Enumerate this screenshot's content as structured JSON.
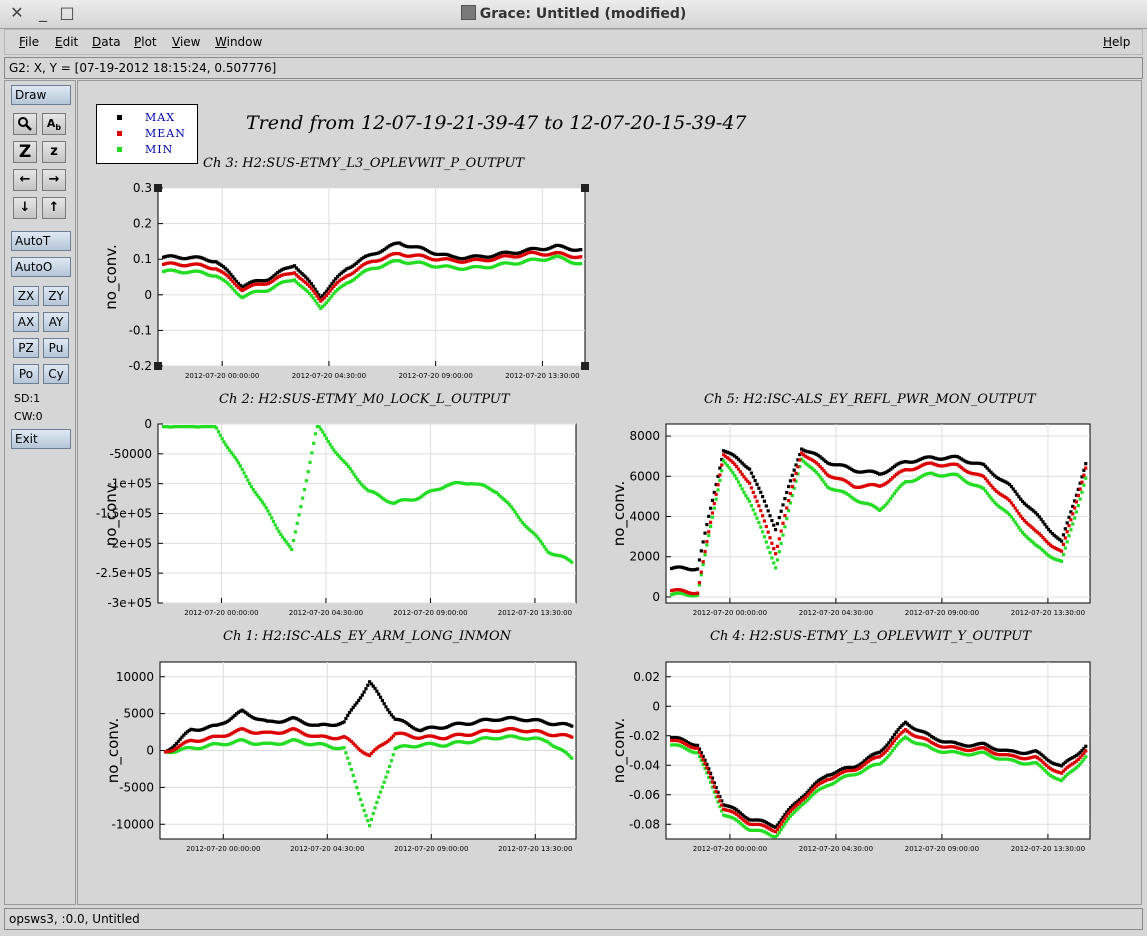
{
  "window": {
    "title": "Grace: Untitled (modified)"
  },
  "menu": {
    "items": [
      "File",
      "Edit",
      "Data",
      "Plot",
      "View",
      "Window"
    ],
    "help": "Help"
  },
  "locator": {
    "text": "G2: X, Y = [07-19-2012 18:15:24, 0.507776]"
  },
  "toolbar": {
    "draw": "Draw",
    "autot": "AutoT",
    "autoo": "AutoO",
    "exit": "Exit",
    "zx": "ZX",
    "zy": "ZY",
    "ax": "AX",
    "ay": "AY",
    "pz": "PZ",
    "pu": "Pu",
    "po": "Po",
    "cy": "Cy",
    "sd": "SD:1",
    "cw": "CW:0",
    "icons": {
      "zoom": "Z",
      "z_small": "z"
    }
  },
  "status": {
    "text": "opsws3, :0.0, Untitled"
  },
  "plot": {
    "main_title": "Trend from 12-07-19-21-39-47 to 12-07-20-15-39-47",
    "legend": [
      "MAX",
      "MEAN",
      "MIN"
    ],
    "colors": {
      "max": "#000000",
      "mean": "#dd0000",
      "min": "#22dd22"
    }
  },
  "chart_data": [
    {
      "type": "scatter",
      "title": "Ch 3: H2:SUS-ETMY_L3_OPLEVWIT_P_OUTPUT",
      "ylabel": "no_conv.",
      "x_ticks": [
        "2012-07-20 00:00:00",
        "2012-07-20 04:30:00",
        "2012-07-20 09:00:00",
        "2012-07-20 13:30:00"
      ],
      "y_ticks": [
        "0.3",
        "0.2",
        "0.1",
        "0",
        "-0.1",
        "-0.2"
      ],
      "ylim": [
        -0.2,
        0.3
      ],
      "series": [
        {
          "name": "MAX",
          "values": [
            0.11,
            0.11,
            0.1,
            0.03,
            0.05,
            0.09,
            0.0,
            0.08,
            0.12,
            0.15,
            0.13,
            0.11,
            0.11,
            0.12,
            0.13,
            0.14,
            0.13
          ]
        },
        {
          "name": "MEAN",
          "values": [
            0.09,
            0.09,
            0.08,
            0.02,
            0.04,
            0.07,
            -0.01,
            0.06,
            0.1,
            0.12,
            0.11,
            0.1,
            0.1,
            0.11,
            0.12,
            0.12,
            0.11
          ]
        },
        {
          "name": "MIN",
          "values": [
            0.07,
            0.07,
            0.06,
            0.0,
            0.02,
            0.05,
            -0.03,
            0.04,
            0.08,
            0.1,
            0.09,
            0.08,
            0.08,
            0.09,
            0.1,
            0.11,
            0.09
          ]
        }
      ]
    },
    {
      "type": "scatter",
      "title": "Ch 2: H2:SUS-ETMY_M0_LOCK_L_OUTPUT",
      "ylabel": "no_conv.",
      "x_ticks": [
        "2012-07-20 00:00:00",
        "2012-07-20 04:30:00",
        "2012-07-20 09:00:00",
        "2012-07-20 13:30:00"
      ],
      "y_ticks": [
        "0",
        "-50000",
        "-1e+05",
        "-1.5e+05",
        "-2e+05",
        "-2.5e+05",
        "-3e+05"
      ],
      "ylim": [
        -300000,
        0
      ],
      "series": [
        {
          "name": "MEAN",
          "values": [
            0,
            0,
            0,
            -70000,
            -140000,
            -210000,
            0,
            -60000,
            -110000,
            -130000,
            -120000,
            -100000,
            -95000,
            -110000,
            -160000,
            -210000,
            -230000
          ]
        }
      ]
    },
    {
      "type": "scatter",
      "title": "Ch 5: H2:ISC-ALS_EY_REFL_PWR_MON_OUTPUT",
      "ylabel": "no_conv.",
      "x_ticks": [
        "2012-07-20 00:00:00",
        "2012-07-20 04:30:00",
        "2012-07-20 09:00:00",
        "2012-07-20 13:30:00"
      ],
      "y_ticks": [
        "8000",
        "6000",
        "4000",
        "2000",
        "0"
      ],
      "ylim": [
        -300,
        8600
      ],
      "series": [
        {
          "name": "MAX",
          "values": [
            1500,
            1500,
            7400,
            6500,
            3500,
            7500,
            6800,
            6400,
            6200,
            6800,
            7000,
            7000,
            6600,
            5600,
            4200,
            2800,
            7000
          ]
        },
        {
          "name": "MEAN",
          "values": [
            400,
            300,
            7200,
            5800,
            2300,
            7300,
            6200,
            5600,
            5600,
            6400,
            6700,
            6600,
            6000,
            4800,
            3300,
            2300,
            6800
          ]
        },
        {
          "name": "MIN",
          "values": [
            200,
            200,
            6900,
            4900,
            1600,
            7000,
            5600,
            5000,
            4400,
            5800,
            6200,
            6100,
            5400,
            4100,
            2600,
            1800,
            6300
          ]
        }
      ]
    },
    {
      "type": "scatter",
      "title": "Ch 1: H2:ISC-ALS_EY_ARM_LONG_INMON",
      "ylabel": "no_conv.",
      "x_ticks": [
        "2012-07-20 00:00:00",
        "2012-07-20 04:30:00",
        "2012-07-20 09:00:00",
        "2012-07-20 13:30:00"
      ],
      "y_ticks": [
        "10000",
        "5000",
        "0",
        "-5000",
        "-10000"
      ],
      "ylim": [
        -12000,
        12000
      ],
      "series": [
        {
          "name": "MAX",
          "values": [
            0,
            3000,
            3500,
            5500,
            4000,
            4500,
            3500,
            4000,
            9500,
            4500,
            3000,
            3500,
            4000,
            4500,
            4500,
            4000,
            3500
          ]
        },
        {
          "name": "MEAN",
          "values": [
            0,
            1500,
            2000,
            3000,
            2500,
            3000,
            2000,
            2000,
            -500,
            2500,
            2000,
            2000,
            2500,
            3000,
            3000,
            2500,
            2000
          ]
        },
        {
          "name": "MIN",
          "values": [
            0,
            500,
            1000,
            1500,
            1000,
            1500,
            1000,
            500,
            -10000,
            500,
            1000,
            1000,
            1500,
            2000,
            2000,
            1500,
            -1000
          ]
        }
      ]
    },
    {
      "type": "scatter",
      "title": "Ch 4: H2:SUS-ETMY_L3_OPLEVWIT_Y_OUTPUT",
      "ylabel": "no_conv.",
      "x_ticks": [
        "2012-07-20 00:00:00",
        "2012-07-20 04:30:00",
        "2012-07-20 09:00:00",
        "2012-07-20 13:30:00"
      ],
      "y_ticks": [
        "0.02",
        "0",
        "-0.02",
        "-0.04",
        "-0.06",
        "-0.08"
      ],
      "ylim": [
        -0.09,
        0.03
      ],
      "series": [
        {
          "name": "MAX",
          "values": [
            -0.02,
            -0.025,
            -0.065,
            -0.075,
            -0.08,
            -0.06,
            -0.045,
            -0.04,
            -0.03,
            -0.01,
            -0.02,
            -0.025,
            -0.025,
            -0.03,
            -0.03,
            -0.04,
            -0.025
          ]
        },
        {
          "name": "MEAN",
          "values": [
            -0.022,
            -0.027,
            -0.068,
            -0.078,
            -0.083,
            -0.062,
            -0.048,
            -0.042,
            -0.033,
            -0.015,
            -0.024,
            -0.028,
            -0.028,
            -0.033,
            -0.034,
            -0.045,
            -0.028
          ]
        },
        {
          "name": "MIN",
          "values": [
            -0.025,
            -0.03,
            -0.072,
            -0.082,
            -0.087,
            -0.065,
            -0.052,
            -0.045,
            -0.038,
            -0.02,
            -0.028,
            -0.031,
            -0.031,
            -0.036,
            -0.038,
            -0.05,
            -0.032
          ]
        }
      ]
    }
  ]
}
